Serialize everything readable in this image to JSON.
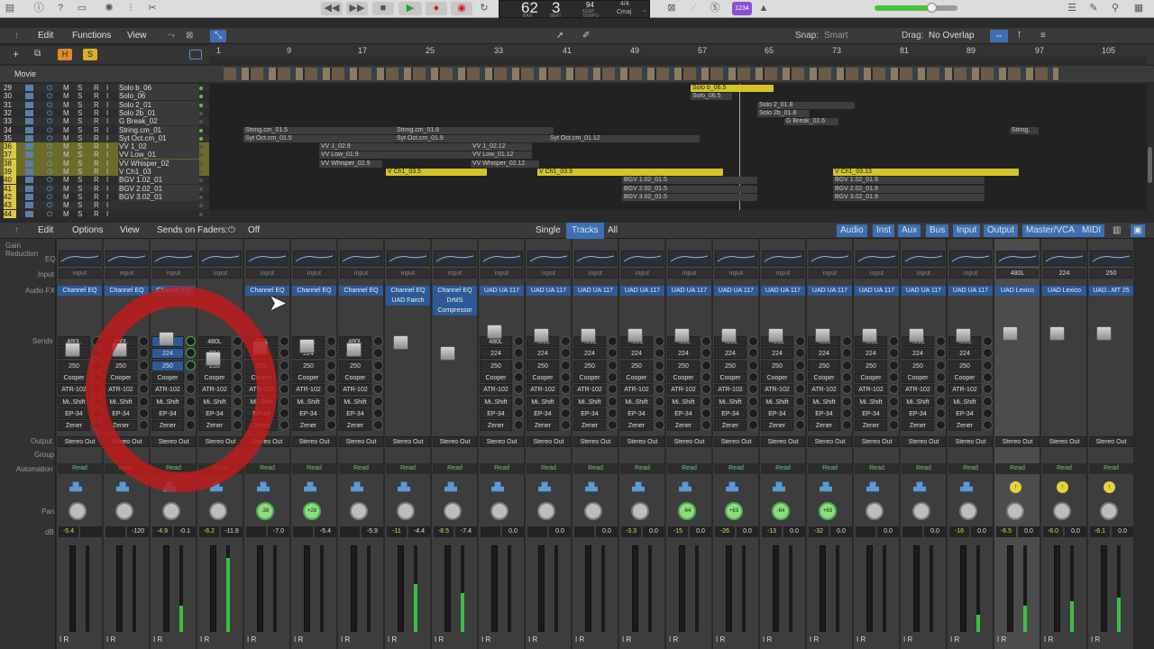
{
  "transport": {
    "bar": "62",
    "beat": "3",
    "bar_label": "BAR",
    "beat_label": "BEAT",
    "tempo": "94",
    "tempo_label": "KEEP",
    "tempo_sub": "TEMPO",
    "sig": "4/4",
    "key": "Cmaj",
    "badge": "1234"
  },
  "tracks_menu": {
    "edit": "Edit",
    "functions": "Functions",
    "view": "View",
    "snap_label": "Snap:",
    "snap_value": "Smart",
    "drag_label": "Drag:",
    "drag_value": "No Overlap"
  },
  "ruler": [
    "1",
    "9",
    "17",
    "25",
    "33",
    "41",
    "49",
    "57",
    "65",
    "73",
    "81",
    "89",
    "97",
    "105"
  ],
  "movie_label": "Movie",
  "tracks": [
    {
      "num": "29",
      "name": "Solo b_06"
    },
    {
      "num": "30",
      "name": "Solo_06"
    },
    {
      "num": "31",
      "name": "Solo 2_01"
    },
    {
      "num": "32",
      "name": "Solo 2b_01"
    },
    {
      "num": "33",
      "name": "G Break_02"
    },
    {
      "num": "34",
      "name": "String.cm_01"
    },
    {
      "num": "35",
      "name": "Syt Oct.cm_01"
    },
    {
      "num": "36",
      "name": "VV 1_02"
    },
    {
      "num": "37",
      "name": "VV Low_01"
    },
    {
      "num": "38",
      "name": "VV Whisper_02"
    },
    {
      "num": "39",
      "name": "V Ch1_03"
    },
    {
      "num": "40",
      "name": "BGV 1.02_01"
    },
    {
      "num": "41",
      "name": "BGV 2.02_01"
    },
    {
      "num": "42",
      "name": "BGV 3.02_01"
    },
    {
      "num": "43",
      "name": ""
    },
    {
      "num": "44",
      "name": ""
    }
  ],
  "track_buttons": {
    "m": "M",
    "s": "S",
    "r": "R",
    "i": "I"
  },
  "regions": [
    {
      "label": "Solo b_06.5",
      "color": "yellow"
    },
    {
      "label": "Solo_06.5",
      "color": "grey"
    },
    {
      "label": "Solo 2_01.8",
      "color": "grey"
    },
    {
      "label": "Solo 2b_01.8",
      "color": "grey"
    },
    {
      "label": "G Break_02.6",
      "color": "grey"
    },
    {
      "label": "String.cm_01.5",
      "color": "grey"
    },
    {
      "label": "String.cm_01.8",
      "color": "grey"
    },
    {
      "label": "String.",
      "color": "grey"
    },
    {
      "label": "Syt Oct.cm_01.5",
      "color": "grey"
    },
    {
      "label": "Syt Oct.cm_01.9",
      "color": "grey"
    },
    {
      "label": "Syt Oct.cm_01.12",
      "color": "grey"
    },
    {
      "label": "VV 1_02.9",
      "color": "grey"
    },
    {
      "label": "VV 1_02.12",
      "color": "grey"
    },
    {
      "label": "VV Low_01.9",
      "color": "grey"
    },
    {
      "label": "VV Low_01.12",
      "color": "grey"
    },
    {
      "label": "VV Whisper_02.9",
      "color": "grey"
    },
    {
      "label": "VV Whisper_02.12",
      "color": "grey"
    },
    {
      "label": "V Ch1_03.5",
      "color": "yellow"
    },
    {
      "label": "V Ch1_03.9",
      "color": "yellow"
    },
    {
      "label": "V Ch1_03.13",
      "color": "yellow"
    },
    {
      "label": "BGV 1.02_01.5",
      "color": "grey"
    },
    {
      "label": "BGV 2.02_01.5",
      "color": "grey"
    },
    {
      "label": "BGV 3.02_01.5",
      "color": "grey"
    },
    {
      "label": "BGV 1.02_01.9",
      "color": "grey"
    },
    {
      "label": "BGV 2.02_01.9",
      "color": "grey"
    },
    {
      "label": "BGV 3.02_01.9",
      "color": "grey"
    }
  ],
  "mixer_menu": {
    "edit": "Edit",
    "options": "Options",
    "view": "View",
    "sends_label": "Sends on Faders:",
    "sends_value": "Off",
    "single": "Single",
    "tracks": "Tracks",
    "all": "All",
    "filters": [
      "Audio",
      "Inst",
      "Aux",
      "Bus",
      "Input",
      "Output",
      "Master/VCA",
      "MIDI"
    ]
  },
  "row_labels": {
    "gain": "Gain Reduction",
    "eq": "EQ",
    "input": "Input",
    "fx": "Audio FX",
    "sends": "Sends",
    "output": "Output",
    "group": "Group",
    "automation": "Automation",
    "pan": "Pan",
    "db": "dB"
  },
  "input_text": "input",
  "strips": [
    {
      "fx": [
        "Channel EQ"
      ],
      "sends": [
        "480L",
        "224",
        "250",
        "Cooper",
        "ATR-102",
        "Mi..Shift",
        "EP-34",
        "Zener"
      ],
      "out": "Stereo Out",
      "auto": "Read",
      "pan": "",
      "db1": "-5.4",
      "db2": "",
      "meter": 0
    },
    {
      "fx": [
        "Channel EQ"
      ],
      "sends": [
        "480L",
        "224",
        "250",
        "Cooper",
        "ATR-102",
        "Mi..Shift",
        "EP-34",
        "Zener"
      ],
      "out": "Stereo Out",
      "auto": "Read",
      "pan": "",
      "db1": "",
      "db2": "-120",
      "meter": 0
    },
    {
      "fx": [
        "Channel EQ"
      ],
      "sends": [
        "-9.6",
        "224",
        "250",
        "Cooper",
        "ATR-102",
        "Mi..Shift",
        "EP-34",
        "Zener"
      ],
      "out": "Stereo Out",
      "auto": "Read",
      "pan": "",
      "db1": "-4.9",
      "db2": "-0.1",
      "meter": 0.3
    },
    {
      "fx": [],
      "sends": [
        "480L",
        "224",
        "250",
        "Cooper",
        "ATR-102",
        "Mi..Shift",
        "EP-34",
        "Zener"
      ],
      "out": "Stereo Out",
      "auto": "Read",
      "pan": "",
      "db1": "-6.2",
      "db2": "-11.9",
      "meter": 0.85
    },
    {
      "fx": [
        "Channel EQ"
      ],
      "sends": [
        "480L",
        "224",
        "250",
        "Cooper",
        "ATR-102",
        "Mi..Shift",
        "EP-34",
        "Zener"
      ],
      "out": "Stereo Out",
      "auto": "Read",
      "pan": "-38",
      "db1": "",
      "db2": "-7.0",
      "meter": 0
    },
    {
      "fx": [
        "Channel EQ"
      ],
      "sends": [
        "480L",
        "224",
        "250",
        "Cooper",
        "ATR-102",
        "Mi..Shift",
        "EP-34",
        "Zener"
      ],
      "out": "Stereo Out",
      "auto": "Read",
      "pan": "+28",
      "db1": "",
      "db2": "-5.4",
      "meter": 0
    },
    {
      "fx": [
        "Channel EQ"
      ],
      "sends": [
        "480L",
        "224",
        "250",
        "Cooper",
        "ATR-102",
        "Mi..Shift",
        "EP-34",
        "Zener"
      ],
      "out": "Stereo Out",
      "auto": "Read",
      "pan": "",
      "db1": "",
      "db2": "-5.9",
      "meter": 0
    },
    {
      "fx": [
        "Channel EQ",
        "UAD Fairch"
      ],
      "sends": [],
      "out": "Stereo Out",
      "auto": "Read",
      "pan": "",
      "db1": "-11",
      "db2": "-4.4",
      "meter": 0.55
    },
    {
      "fx": [
        "Channel EQ",
        "DrMS",
        "Compressor"
      ],
      "sends": [],
      "out": "Stereo Out",
      "auto": "Read",
      "pan": "",
      "db1": "-8.5",
      "db2": "-7.4",
      "meter": 0.45
    },
    {
      "fx": [
        "UAD UA 117"
      ],
      "sends": [
        "480L",
        "224",
        "250",
        "Cooper",
        "ATR-102",
        "Mi..Shift",
        "EP-34",
        "Zener"
      ],
      "out": "Stereo Out",
      "auto": "Read",
      "pan": "",
      "db1": "",
      "db2": "0.0",
      "meter": 0
    },
    {
      "fx": [
        "UAD UA 117"
      ],
      "sends": [
        "480L",
        "224",
        "250",
        "Cooper",
        "ATR-102",
        "Mi..Shift",
        "EP-34",
        "Zener"
      ],
      "out": "Stereo Out",
      "auto": "Read",
      "pan": "",
      "db1": "",
      "db2": "0.0",
      "meter": 0
    },
    {
      "fx": [
        "UAD UA 117"
      ],
      "sends": [
        "480L",
        "224",
        "250",
        "Cooper",
        "ATR-102",
        "Mi..Shift",
        "EP-34",
        "Zener"
      ],
      "out": "Stereo Out",
      "auto": "Read",
      "pan": "",
      "db1": "",
      "db2": "0.0",
      "meter": 0
    },
    {
      "fx": [
        "UAD UA 117"
      ],
      "sends": [
        "480L",
        "224",
        "250",
        "Cooper",
        "ATR-102",
        "Mi..Shift",
        "EP-34",
        "Zener"
      ],
      "out": "Stereo Out",
      "auto": "Read",
      "pan": "",
      "db1": "-3.3",
      "db2": "0.0",
      "meter": 0
    },
    {
      "fx": [
        "UAD UA 117"
      ],
      "sends": [
        "480L",
        "224",
        "250",
        "Cooper",
        "ATR-102",
        "Mi..Shift",
        "EP-34",
        "Zener"
      ],
      "out": "Stereo Out",
      "auto": "Read",
      "pan": "-64",
      "db1": "-15",
      "db2": "0.0",
      "meter": 0
    },
    {
      "fx": [
        "UAD UA 117"
      ],
      "sends": [
        "480L",
        "224",
        "250",
        "Cooper",
        "ATR-102",
        "Mi..Shift",
        "EP-34",
        "Zener"
      ],
      "out": "Stereo Out",
      "auto": "Read",
      "pan": "+63",
      "db1": "-26",
      "db2": "0.0",
      "meter": 0
    },
    {
      "fx": [
        "UAD UA 117"
      ],
      "sends": [
        "480L",
        "224",
        "250",
        "Cooper",
        "ATR-102",
        "Mi..Shift",
        "EP-34",
        "Zener"
      ],
      "out": "Stereo Out",
      "auto": "Read",
      "pan": "-64",
      "db1": "-13",
      "db2": "0.0",
      "meter": 0
    },
    {
      "fx": [
        "UAD UA 117"
      ],
      "sends": [
        "480L",
        "224",
        "250",
        "Cooper",
        "ATR-102",
        "Mi..Shift",
        "EP-34",
        "Zener"
      ],
      "out": "Stereo Out",
      "auto": "Read",
      "pan": "+63",
      "db1": "-32",
      "db2": "0.0",
      "meter": 0
    },
    {
      "fx": [
        "UAD UA 117"
      ],
      "sends": [
        "480L",
        "224",
        "250",
        "Cooper",
        "ATR-102",
        "Mi..Shift",
        "EP-34",
        "Zener"
      ],
      "out": "Stereo Out",
      "auto": "Read",
      "pan": "",
      "db1": "",
      "db2": "0.0",
      "meter": 0
    },
    {
      "fx": [
        "UAD UA 117"
      ],
      "sends": [
        "480L",
        "224",
        "250",
        "Cooper",
        "ATR-102",
        "Mi..Shift",
        "EP-34",
        "Zener"
      ],
      "out": "Stereo Out",
      "auto": "Read",
      "pan": "",
      "db1": "",
      "db2": "0.0",
      "meter": 0
    },
    {
      "fx": [
        "UAD UA 117"
      ],
      "sends": [
        "480L",
        "224",
        "250",
        "Cooper",
        "ATR-102",
        "Mi..Shift",
        "EP-34",
        "Zener"
      ],
      "out": "Stereo Out",
      "auto": "Read",
      "pan": "",
      "db1": "-16",
      "db2": "0.0",
      "meter": 0.2
    },
    {
      "fx": [
        "UAD Lexico"
      ],
      "sends": [],
      "out": "Stereo Out",
      "auto": "Read",
      "pan": "",
      "db1": "-6.5",
      "db2": "0.0",
      "meter": 0.3,
      "input": "480L"
    },
    {
      "fx": [
        "UAD Lexico"
      ],
      "sends": [],
      "out": "Stereo Out",
      "auto": "Read",
      "pan": "",
      "db1": "-6.0",
      "db2": "0.0",
      "meter": 0.35,
      "input": "224"
    },
    {
      "fx": [
        "UAD...MT 25"
      ],
      "sends": [],
      "out": "Stereo Out",
      "auto": "Read",
      "pan": "",
      "db1": "-6.1",
      "db2": "0.0",
      "meter": 0.4,
      "input": "250"
    }
  ],
  "ir_text": "I R"
}
